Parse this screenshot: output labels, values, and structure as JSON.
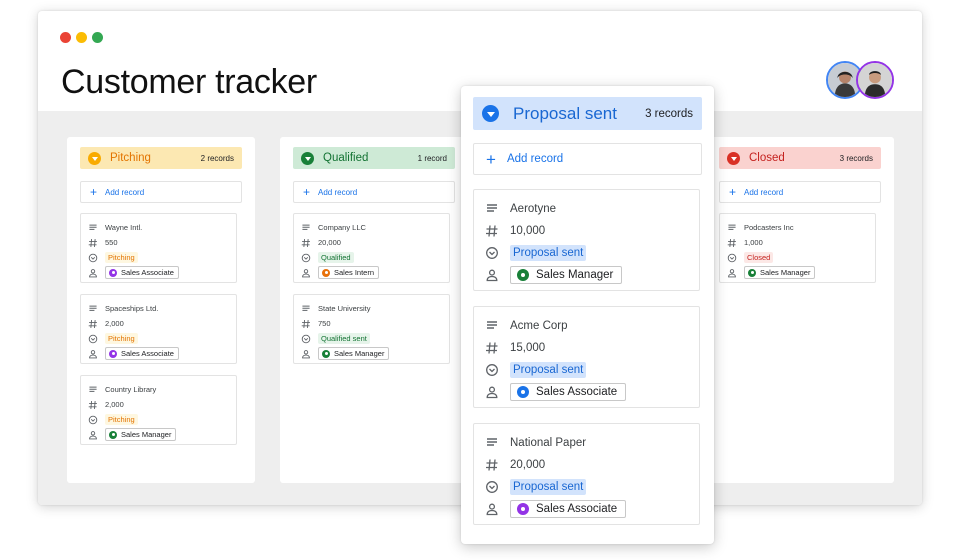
{
  "app": {
    "title": "Customer tracker"
  },
  "colors": {
    "accent": "#1a73e8",
    "traffic": [
      "#ea4335",
      "#fbbc04",
      "#34a853"
    ],
    "avatar_borders": [
      "#4285f4",
      "#9334e6"
    ]
  },
  "columns": [
    {
      "name": "Pitching",
      "count": "2 records",
      "header_bg": "#fce8b2",
      "header_fg": "#e37400",
      "chev_bg": "#f9ab00",
      "add_label": "Add record",
      "cards": [
        {
          "name": "Wayne Intl.",
          "number": "550",
          "status": "Pitching",
          "status_bg": "#fef7e0",
          "status_fg": "#e37400",
          "person": "Sales Associate",
          "person_color": "#9334e6"
        },
        {
          "name": "Spaceships Ltd.",
          "number": "2,000",
          "status": "Pitching",
          "status_bg": "#fef7e0",
          "status_fg": "#e37400",
          "person": "Sales Associate",
          "person_color": "#9334e6"
        },
        {
          "name": "Country Library",
          "number": "2,000",
          "status": "Pitching",
          "status_bg": "#fef7e0",
          "status_fg": "#e37400",
          "person": "Sales Manager",
          "person_color": "#188038"
        }
      ]
    },
    {
      "name": "Qualified",
      "count": "1 record",
      "header_bg": "#ceead6",
      "header_fg": "#137333",
      "chev_bg": "#188038",
      "add_label": "Add record",
      "cards": [
        {
          "name": "Company LLC",
          "number": "20,000",
          "status": "Qualified",
          "status_bg": "#e6f4ea",
          "status_fg": "#137333",
          "person": "Sales Intern",
          "person_color": "#e8710a"
        },
        {
          "name": "State University",
          "number": "750",
          "status": "Qualified sent",
          "status_bg": "#e6f4ea",
          "status_fg": "#137333",
          "person": "Sales Manager",
          "person_color": "#188038"
        }
      ]
    },
    {
      "name": "Closed",
      "count": "3 records",
      "header_bg": "#fad2cf",
      "header_fg": "#c5221f",
      "chev_bg": "#d93025",
      "add_label": "Add record",
      "cards": [
        {
          "name": "Podcasters Inc",
          "number": "1,000",
          "status": "Closed",
          "status_bg": "#fce8e6",
          "status_fg": "#c5221f",
          "person": "Sales Manager",
          "person_color": "#188038"
        }
      ]
    }
  ],
  "proposal": {
    "name": "Proposal sent",
    "count": "3 records",
    "header_bg": "#d2e3fc",
    "header_fg": "#1967d2",
    "chev_bg": "#1a73e8",
    "add_label": "Add record",
    "cards": [
      {
        "name": "Aerotyne",
        "number": "10,000",
        "status": "Proposal sent",
        "status_bg": "#d2e3fc",
        "status_fg": "#1967d2",
        "person": "Sales Manager",
        "person_color": "#188038"
      },
      {
        "name": "Acme Corp",
        "number": "15,000",
        "status": "Proposal sent",
        "status_bg": "#d2e3fc",
        "status_fg": "#1967d2",
        "person": "Sales Associate",
        "person_color": "#1a73e8"
      },
      {
        "name": "National Paper",
        "number": "20,000",
        "status": "Proposal sent",
        "status_bg": "#d2e3fc",
        "status_fg": "#1967d2",
        "person": "Sales Associate",
        "person_color": "#9334e6"
      }
    ]
  }
}
